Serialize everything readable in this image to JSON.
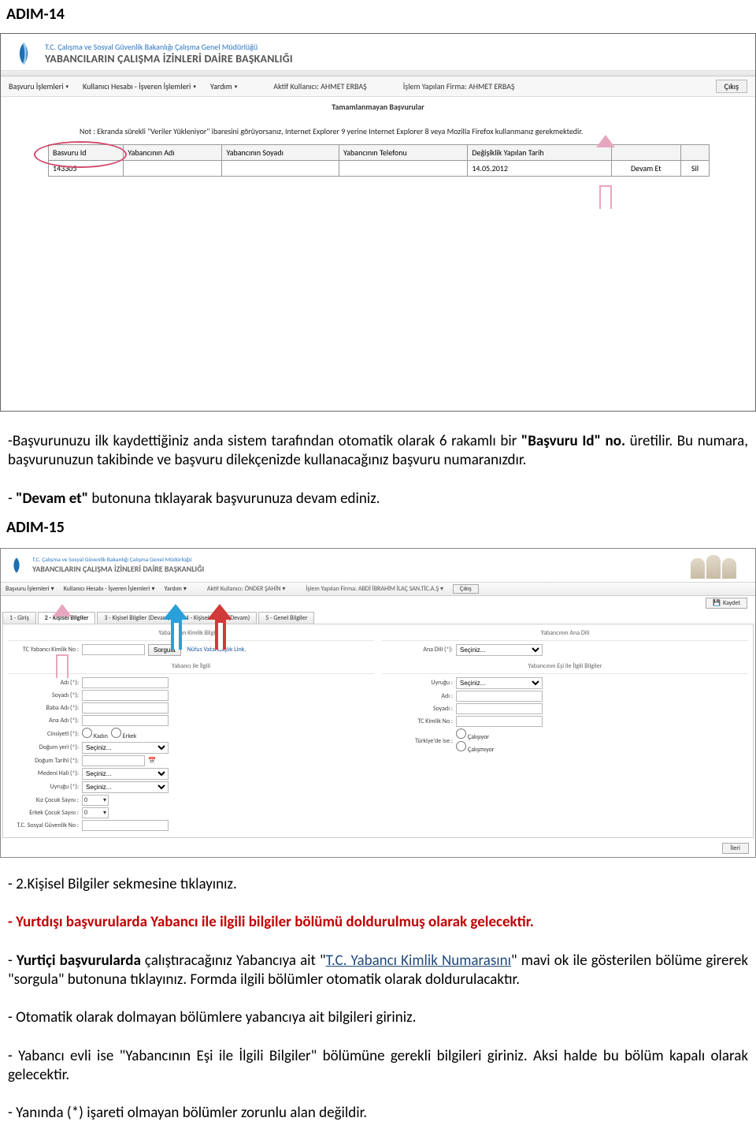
{
  "step14": "ADIM-14",
  "step15": "ADIM-15",
  "ministry": "T.C. Çalışma ve Sosyal Güvenlik Bakanlığı Çalışma Genel Müdürlüğü",
  "dept": "YABANCILARIN ÇALIŞMA İZİNLERİ DAİRE BAŞKANLIĞI",
  "shot1": {
    "menu": {
      "m1": "Başvuru İşlemleri",
      "m2": "Kullanıcı Hesabı - İşveren İşlemleri",
      "m3": "Yardım",
      "aktif_lbl": "Aktif Kullanıcı:",
      "aktif_val": "AHMET ERBAŞ",
      "firma_lbl": "İşlem Yapılan Firma:",
      "firma_val": "AHMET ERBAŞ",
      "cikis": "Çıkış"
    },
    "sub": "Tamamlanmayan Başvurular",
    "note": "Not : Ekranda sürekli \"Veriler Yükleniyor\" ibaresini görüyorsanız, Internet Explorer 9 yerine Internet Explorer 8 veya Mozilla Firefox kullanmanız gerekmektedir.",
    "cols": {
      "c1": "Basvuru Id",
      "c2": "Yabancının Adı",
      "c3": "Yabancının Soyadı",
      "c4": "Yabancının Telefonu",
      "c5": "Değişiklik Yapılan Tarih"
    },
    "row": {
      "id": "143305",
      "tarih": "14.05.2012",
      "devam": "Devam Et",
      "sil": "Sil"
    }
  },
  "para1a": "-Başvurunuzu ilk kaydettiğiniz anda sistem tarafından otomatik olarak 6 rakamlı bir ",
  "para1b": "\"Başvuru Id\" no.",
  "para1c": " üretilir. Bu numara, başvurunuzun takibinde ve başvuru dilekçenizde kullanacağınız başvuru numaranızdır.",
  "para2a": "- ",
  "para2b": "\"Devam et\"",
  "para2c": " butonuna tıklayarak başvurunuza devam ediniz.",
  "shot2": {
    "menu": {
      "m1": "Başvuru İşlemleri",
      "m2": "Kullanıcı Hesabı - İşveren İşlemleri",
      "m3": "Yardım",
      "aktif": "Aktif Kullanıcı: ÖNDER ŞAHİN",
      "firma": "İşlem Yapılan Firma: ABDİ İBRAHİM İLAÇ SAN.TİC.A.Ş",
      "cikis": "Çıkış"
    },
    "kaydet": "Kaydet",
    "tabs": {
      "t1": "1 - Giriş",
      "t2": "2 - Kişisel Bilgiler",
      "t3": "3 - Kişisel Bilgiler (Devam)",
      "t4": "4 - Kişisel Bilgiler(Devam)",
      "t5": "5 - Genel Bilgiler"
    },
    "fs": {
      "kimlik": "Yabancının Kimlik Bilgileri",
      "anaDili": "Yabancının Ana Dili",
      "yabanci": "Yabancı ile İlgili",
      "esi": "Yabancının Eşi ile İlgili Bilgiler"
    },
    "fields": {
      "tc_kimlik_lbl": "TC Yabancı Kimlik No :",
      "sorgula": "Sorgula",
      "nufus_link": "Nüfus Vatandaşlık Link.",
      "anaDili_lbl": "Ana Dili (*):",
      "seciniz": "Seçiniz...",
      "adi": "Adı (*):",
      "soyadi": "Soyadı (*):",
      "baba": "Baba Adı (*):",
      "ana": "Ana Adı (*):",
      "cinsiyet": "Cinsiyeti (*):",
      "kadin": "Kadın",
      "erkek": "Erkek",
      "dogumyeri": "Doğum yeri (*):",
      "dogumtarih": "Doğum Tarihi (*):",
      "medeni": "Medeni Hali (*):",
      "uyrugu": "Uyruğu (*):",
      "kiz": "Kız Çocuk Sayısı :",
      "erkekc": "Erkek Çocuk Sayısı :",
      "sgk": "T.C. Sosyal Güvenlik No :",
      "e_uyrugu": "Uyruğu :",
      "e_adi": "Adı :",
      "e_soyadi": "Soyadı :",
      "e_tc": "TC Kimlik No :",
      "e_turkiye": "Türkiye'de ise :",
      "calisiyor": "Çalışıyor",
      "calismiyor": "Çalışmıyor",
      "zero": "0"
    },
    "ileri": "İleri"
  },
  "after": {
    "l1": "- 2.Kişisel Bilgiler sekmesine tıklayınız.",
    "l2": "- Yurtdışı başvurularda Yabancı ile ilgili bilgiler bölümü doldurulmuş olarak gelecektir.",
    "l3a": "- ",
    "l3b": "Yurtiçi başvurularda",
    "l3c": " çalıştıracağınız Yabancıya ait \"",
    "l3d": "T.C. Yabancı Kimlik Numarasını",
    "l3e": "\" mavi ok ile gösterilen bölüme girerek \"sorgula\" butonuna tıklayınız.  Formda ilgili bölümler otomatik olarak doldurulacaktır.",
    "l4": "- Otomatik olarak dolmayan bölümlere yabancıya ait bilgileri giriniz.",
    "l5": "- Yabancı  evli ise \"Yabancının Eşi ile İlgili Bilgiler\" bölümüne gerekli bilgileri giriniz. Aksi halde bu bölüm kapalı olarak gelecektir.",
    "l6": "- Yanında (*) işareti olmayan bölümler zorunlu alan değildir."
  }
}
